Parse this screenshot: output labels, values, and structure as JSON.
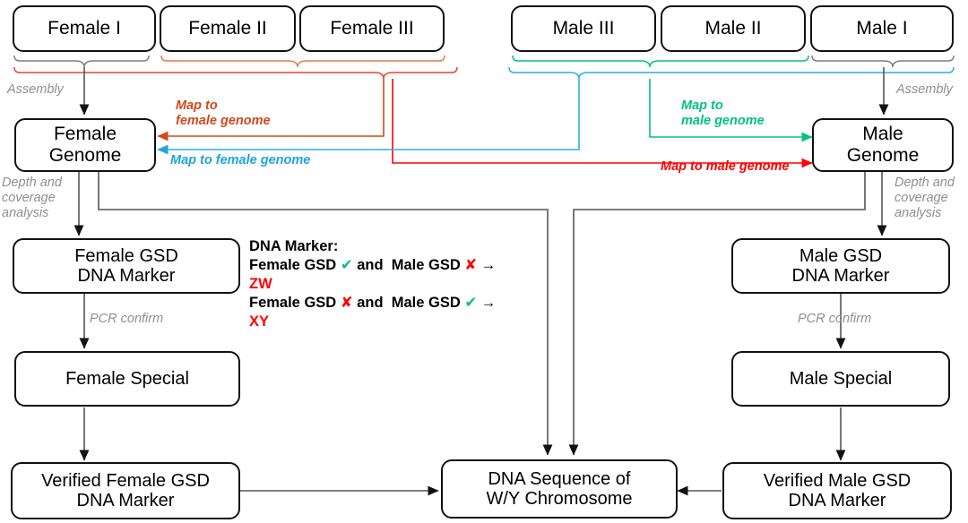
{
  "diagram": {
    "title": "Sex-determination DNA marker workflow",
    "colors": {
      "orange": "#D2491A",
      "blue": "#1FA4DE",
      "green": "#00C281",
      "red": "#FF0000",
      "gray": "#8f8f8f",
      "black": "#111111"
    }
  },
  "samples": {
    "female": [
      {
        "id": "female-1",
        "label": "Female I"
      },
      {
        "id": "female-2",
        "label": "Female II"
      },
      {
        "id": "female-3",
        "label": "Female III"
      }
    ],
    "male": [
      {
        "id": "male-3",
        "label": "Male III"
      },
      {
        "id": "male-2",
        "label": "Male II"
      },
      {
        "id": "male-1",
        "label": "Male I"
      }
    ]
  },
  "nodes": {
    "female_genome": "Female\nGenome",
    "male_genome": "Male\nGenome",
    "female_gsd_marker": "Female GSD\nDNA Marker",
    "male_gsd_marker": "Male GSD\nDNA Marker",
    "female_special": "Female Special",
    "male_special": "Male Special",
    "verified_female": "Verified Female GSD\nDNA Marker",
    "verified_male": "Verified Male GSD\nDNA Marker",
    "dna_sequence": "DNA Sequence of\nW/Y Chromosome"
  },
  "edge_labels": {
    "assembly_left": "Assembly",
    "assembly_right": "Assembly",
    "depth_left": "Depth and\ncoverage\nanalysis",
    "depth_right": "Depth and\ncoverage\nanalysis",
    "pcr_left": "PCR confirm",
    "pcr_right": "PCR confirm",
    "map_female_orange": "Map to\nfemale genome",
    "map_female_blue": "Map to female genome",
    "map_male_green": "Map to\nmale genome",
    "map_male_red": "Map to male genome"
  },
  "legend": {
    "heading": "DNA Marker:",
    "rules": [
      {
        "female_text": "Female GSD",
        "female_mark": "✔",
        "female_mark_kind": "check",
        "conj": "and",
        "male_text": "Male GSD",
        "male_mark": "✘",
        "male_mark_kind": "cross",
        "arrow": "→",
        "result": "ZW"
      },
      {
        "female_text": "Female GSD",
        "female_mark": "✘",
        "female_mark_kind": "cross",
        "conj": "and",
        "male_text": "Male GSD",
        "male_mark": "✔",
        "male_mark_kind": "check",
        "arrow": "→",
        "result": "XY"
      }
    ]
  }
}
